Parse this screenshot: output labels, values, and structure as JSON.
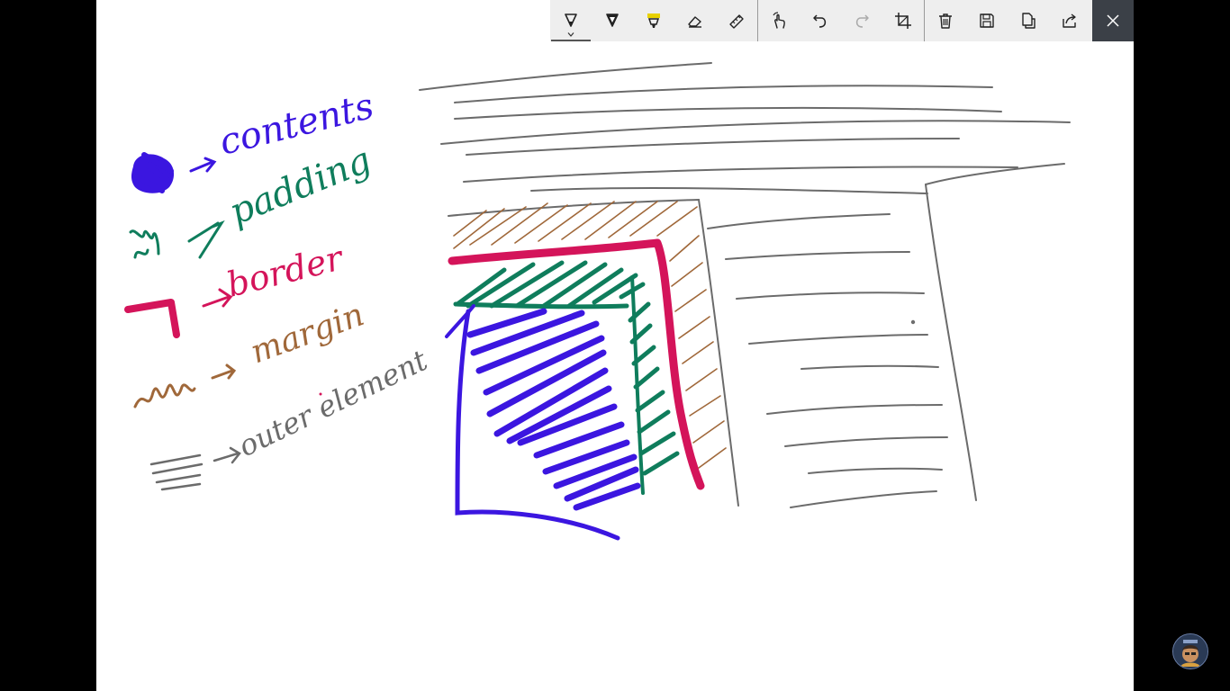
{
  "legend": [
    {
      "label": "contents",
      "color": "#3b16e0"
    },
    {
      "label": "padding",
      "color": "#0f7d5c"
    },
    {
      "label": "border",
      "color": "#d4145a"
    },
    {
      "label": "margin",
      "color": "#a0683a"
    },
    {
      "label": "outer element",
      "color": "#6b6b6b"
    }
  ],
  "toolbar": {
    "tools": [
      {
        "name": "ballpoint-pen",
        "selected": true,
        "has_caret": true
      },
      {
        "name": "pencil"
      },
      {
        "name": "highlighter"
      },
      {
        "name": "eraser"
      },
      {
        "name": "ruler"
      },
      {
        "name": "touch-writing"
      },
      {
        "name": "undo"
      },
      {
        "name": "redo",
        "disabled": true
      },
      {
        "name": "crop"
      },
      {
        "name": "delete"
      },
      {
        "name": "save"
      },
      {
        "name": "copy"
      },
      {
        "name": "share"
      },
      {
        "name": "close"
      }
    ],
    "accent_highlighter": "#e8d100",
    "close_background": "#3b4047"
  },
  "colors": {
    "contents": "#3b16e0",
    "padding": "#0f7d5c",
    "border": "#d4145a",
    "margin": "#a0683a",
    "outer": "#6b6b6b"
  }
}
